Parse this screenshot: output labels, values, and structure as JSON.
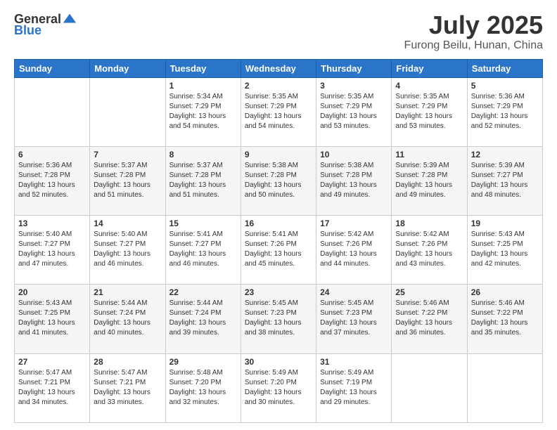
{
  "header": {
    "logo": {
      "text_general": "General",
      "text_blue": "Blue"
    },
    "title": "July 2025",
    "location": "Furong Beilu, Hunan, China"
  },
  "calendar": {
    "days_of_week": [
      "Sunday",
      "Monday",
      "Tuesday",
      "Wednesday",
      "Thursday",
      "Friday",
      "Saturday"
    ],
    "weeks": [
      [
        {
          "day": "",
          "sunrise": "",
          "sunset": "",
          "daylight": ""
        },
        {
          "day": "",
          "sunrise": "",
          "sunset": "",
          "daylight": ""
        },
        {
          "day": "1",
          "sunrise": "Sunrise: 5:34 AM",
          "sunset": "Sunset: 7:29 PM",
          "daylight": "Daylight: 13 hours and 54 minutes."
        },
        {
          "day": "2",
          "sunrise": "Sunrise: 5:35 AM",
          "sunset": "Sunset: 7:29 PM",
          "daylight": "Daylight: 13 hours and 54 minutes."
        },
        {
          "day": "3",
          "sunrise": "Sunrise: 5:35 AM",
          "sunset": "Sunset: 7:29 PM",
          "daylight": "Daylight: 13 hours and 53 minutes."
        },
        {
          "day": "4",
          "sunrise": "Sunrise: 5:35 AM",
          "sunset": "Sunset: 7:29 PM",
          "daylight": "Daylight: 13 hours and 53 minutes."
        },
        {
          "day": "5",
          "sunrise": "Sunrise: 5:36 AM",
          "sunset": "Sunset: 7:29 PM",
          "daylight": "Daylight: 13 hours and 52 minutes."
        }
      ],
      [
        {
          "day": "6",
          "sunrise": "Sunrise: 5:36 AM",
          "sunset": "Sunset: 7:28 PM",
          "daylight": "Daylight: 13 hours and 52 minutes."
        },
        {
          "day": "7",
          "sunrise": "Sunrise: 5:37 AM",
          "sunset": "Sunset: 7:28 PM",
          "daylight": "Daylight: 13 hours and 51 minutes."
        },
        {
          "day": "8",
          "sunrise": "Sunrise: 5:37 AM",
          "sunset": "Sunset: 7:28 PM",
          "daylight": "Daylight: 13 hours and 51 minutes."
        },
        {
          "day": "9",
          "sunrise": "Sunrise: 5:38 AM",
          "sunset": "Sunset: 7:28 PM",
          "daylight": "Daylight: 13 hours and 50 minutes."
        },
        {
          "day": "10",
          "sunrise": "Sunrise: 5:38 AM",
          "sunset": "Sunset: 7:28 PM",
          "daylight": "Daylight: 13 hours and 49 minutes."
        },
        {
          "day": "11",
          "sunrise": "Sunrise: 5:39 AM",
          "sunset": "Sunset: 7:28 PM",
          "daylight": "Daylight: 13 hours and 49 minutes."
        },
        {
          "day": "12",
          "sunrise": "Sunrise: 5:39 AM",
          "sunset": "Sunset: 7:27 PM",
          "daylight": "Daylight: 13 hours and 48 minutes."
        }
      ],
      [
        {
          "day": "13",
          "sunrise": "Sunrise: 5:40 AM",
          "sunset": "Sunset: 7:27 PM",
          "daylight": "Daylight: 13 hours and 47 minutes."
        },
        {
          "day": "14",
          "sunrise": "Sunrise: 5:40 AM",
          "sunset": "Sunset: 7:27 PM",
          "daylight": "Daylight: 13 hours and 46 minutes."
        },
        {
          "day": "15",
          "sunrise": "Sunrise: 5:41 AM",
          "sunset": "Sunset: 7:27 PM",
          "daylight": "Daylight: 13 hours and 46 minutes."
        },
        {
          "day": "16",
          "sunrise": "Sunrise: 5:41 AM",
          "sunset": "Sunset: 7:26 PM",
          "daylight": "Daylight: 13 hours and 45 minutes."
        },
        {
          "day": "17",
          "sunrise": "Sunrise: 5:42 AM",
          "sunset": "Sunset: 7:26 PM",
          "daylight": "Daylight: 13 hours and 44 minutes."
        },
        {
          "day": "18",
          "sunrise": "Sunrise: 5:42 AM",
          "sunset": "Sunset: 7:26 PM",
          "daylight": "Daylight: 13 hours and 43 minutes."
        },
        {
          "day": "19",
          "sunrise": "Sunrise: 5:43 AM",
          "sunset": "Sunset: 7:25 PM",
          "daylight": "Daylight: 13 hours and 42 minutes."
        }
      ],
      [
        {
          "day": "20",
          "sunrise": "Sunrise: 5:43 AM",
          "sunset": "Sunset: 7:25 PM",
          "daylight": "Daylight: 13 hours and 41 minutes."
        },
        {
          "day": "21",
          "sunrise": "Sunrise: 5:44 AM",
          "sunset": "Sunset: 7:24 PM",
          "daylight": "Daylight: 13 hours and 40 minutes."
        },
        {
          "day": "22",
          "sunrise": "Sunrise: 5:44 AM",
          "sunset": "Sunset: 7:24 PM",
          "daylight": "Daylight: 13 hours and 39 minutes."
        },
        {
          "day": "23",
          "sunrise": "Sunrise: 5:45 AM",
          "sunset": "Sunset: 7:23 PM",
          "daylight": "Daylight: 13 hours and 38 minutes."
        },
        {
          "day": "24",
          "sunrise": "Sunrise: 5:45 AM",
          "sunset": "Sunset: 7:23 PM",
          "daylight": "Daylight: 13 hours and 37 minutes."
        },
        {
          "day": "25",
          "sunrise": "Sunrise: 5:46 AM",
          "sunset": "Sunset: 7:22 PM",
          "daylight": "Daylight: 13 hours and 36 minutes."
        },
        {
          "day": "26",
          "sunrise": "Sunrise: 5:46 AM",
          "sunset": "Sunset: 7:22 PM",
          "daylight": "Daylight: 13 hours and 35 minutes."
        }
      ],
      [
        {
          "day": "27",
          "sunrise": "Sunrise: 5:47 AM",
          "sunset": "Sunset: 7:21 PM",
          "daylight": "Daylight: 13 hours and 34 minutes."
        },
        {
          "day": "28",
          "sunrise": "Sunrise: 5:47 AM",
          "sunset": "Sunset: 7:21 PM",
          "daylight": "Daylight: 13 hours and 33 minutes."
        },
        {
          "day": "29",
          "sunrise": "Sunrise: 5:48 AM",
          "sunset": "Sunset: 7:20 PM",
          "daylight": "Daylight: 13 hours and 32 minutes."
        },
        {
          "day": "30",
          "sunrise": "Sunrise: 5:49 AM",
          "sunset": "Sunset: 7:20 PM",
          "daylight": "Daylight: 13 hours and 30 minutes."
        },
        {
          "day": "31",
          "sunrise": "Sunrise: 5:49 AM",
          "sunset": "Sunset: 7:19 PM",
          "daylight": "Daylight: 13 hours and 29 minutes."
        },
        {
          "day": "",
          "sunrise": "",
          "sunset": "",
          "daylight": ""
        },
        {
          "day": "",
          "sunrise": "",
          "sunset": "",
          "daylight": ""
        }
      ]
    ]
  }
}
